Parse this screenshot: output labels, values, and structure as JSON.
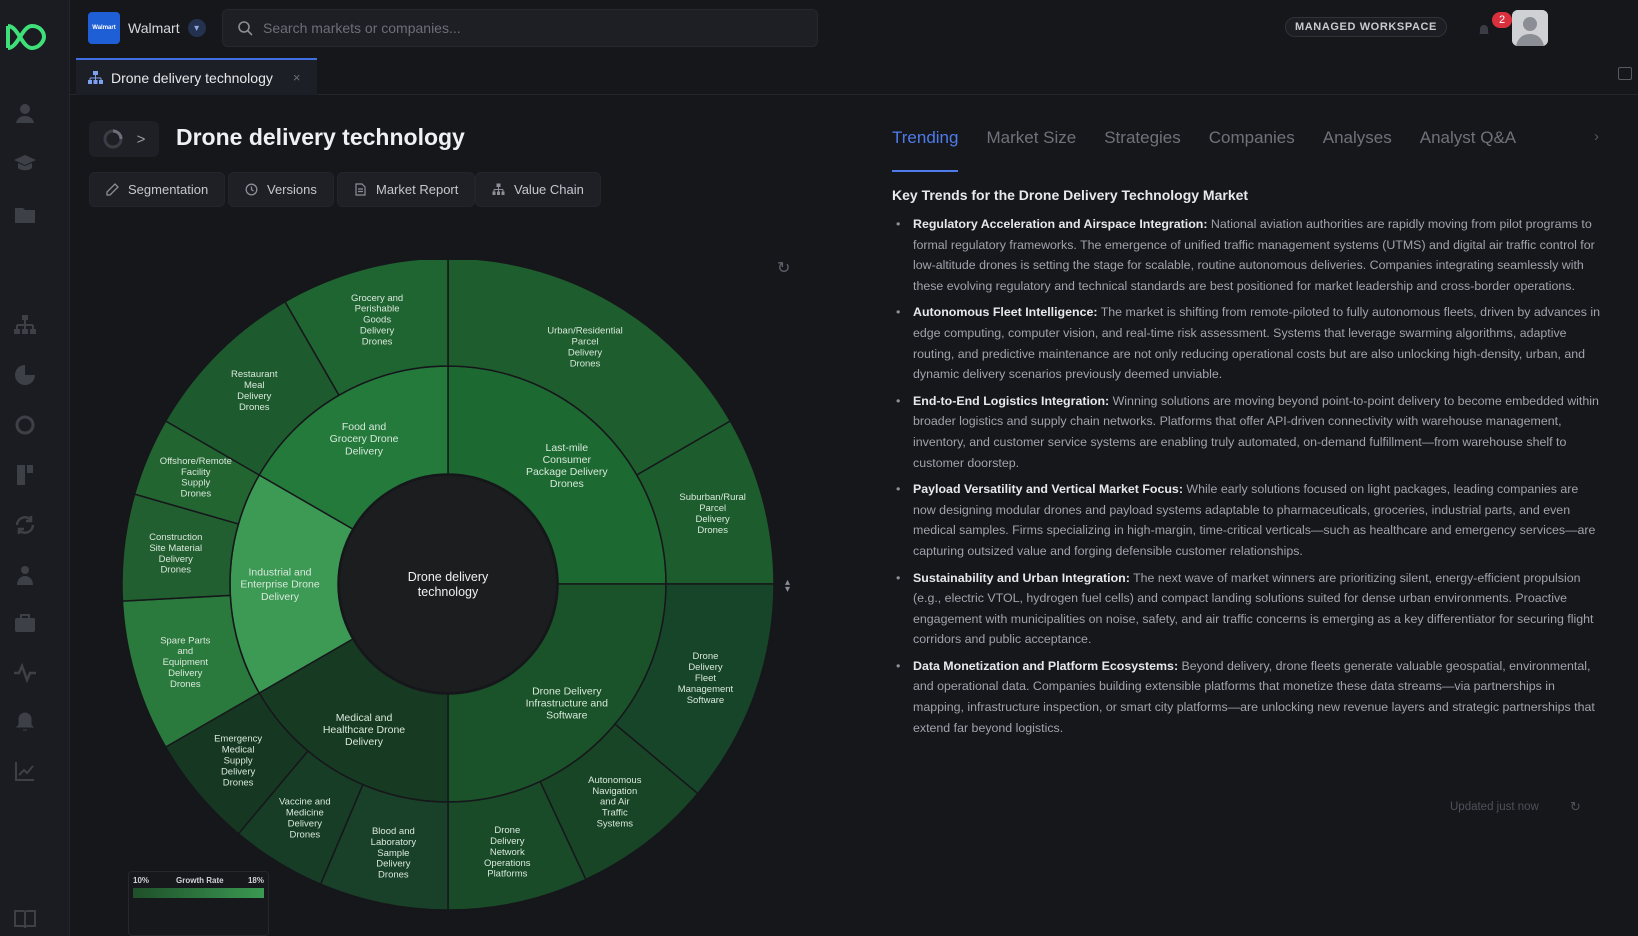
{
  "org": {
    "logo_text": "Walmart",
    "name": "Walmart"
  },
  "search": {
    "placeholder": "Search markets or companies..."
  },
  "header": {
    "workspace_label": "MANAGED WORKSPACE",
    "notification_count": "2"
  },
  "doc_tab": {
    "label": "Drone delivery technology",
    "close": "×"
  },
  "page": {
    "back_label": ">",
    "title": "Drone delivery technology",
    "actions": [
      "Segmentation",
      "Versions",
      "Market Report",
      "Value Chain"
    ]
  },
  "sunburst": {
    "center_label": [
      "Drone delivery",
      "technology"
    ],
    "segments": [
      {
        "name": [
          "Last-mile",
          "Consumer",
          "Package Delivery",
          "Drones"
        ],
        "color": "#1c6a31",
        "children": [
          {
            "name": [
              "Urban/Residential",
              "Parcel",
              "Delivery",
              "Drones"
            ],
            "color": "#1e5d2d"
          },
          {
            "name": [
              "Suburban/Rural",
              "Parcel",
              "Delivery",
              "Drones"
            ],
            "color": "#1d5c2d"
          }
        ]
      },
      {
        "name": [
          "Drone Delivery",
          "Infrastructure and",
          "Software"
        ],
        "color": "#1a5329",
        "children": [
          {
            "name": [
              "Drone",
              "Delivery",
              "Fleet",
              "Management",
              "Software"
            ],
            "color": "#17452a"
          },
          {
            "name": [
              "Autonomous",
              "Navigation",
              "and Air",
              "Traffic",
              "Systems"
            ],
            "color": "#184526"
          },
          {
            "name": [
              "Drone",
              "Delivery",
              "Network",
              "Operations",
              "Platforms"
            ],
            "color": "#194b29"
          }
        ]
      },
      {
        "name": [
          "Medical and",
          "Healthcare Drone",
          "Delivery"
        ],
        "color": "#173a22",
        "children": [
          {
            "name": [
              "Blood and",
              "Laboratory",
              "Sample",
              "Delivery",
              "Drones"
            ],
            "color": "#19412a"
          },
          {
            "name": [
              "Vaccine and",
              "Medicine",
              "Delivery",
              "Drones"
            ],
            "color": "#173d26"
          },
          {
            "name": [
              "Emergency",
              "Medical",
              "Supply",
              "Delivery",
              "Drones"
            ],
            "color": "#163822"
          }
        ]
      },
      {
        "name": [
          "Industrial and",
          "Enterprise Drone",
          "Delivery"
        ],
        "color": "#3d9a55",
        "children": [
          {
            "name": [
              "Spare Parts",
              "and",
              "Equipment",
              "Delivery",
              "Drones"
            ],
            "color": "#2b7a3d"
          },
          {
            "name": [
              "Construction",
              "Site Material",
              "Delivery",
              "Drones"
            ],
            "color": "#215e30"
          },
          {
            "name": [
              "Offshore/Remote",
              "Facility",
              "Supply",
              "Drones"
            ],
            "color": "#236531"
          }
        ]
      },
      {
        "name": [
          "Food and",
          "Grocery Drone",
          "Delivery"
        ],
        "color": "#237a3b",
        "children": [
          {
            "name": [
              "Restaurant",
              "Meal",
              "Delivery",
              "Drones"
            ],
            "color": "#1d5a2d"
          },
          {
            "name": [
              "Grocery and",
              "Perishable",
              "Goods",
              "Delivery",
              "Drones"
            ],
            "color": "#1f6531"
          }
        ]
      }
    ]
  },
  "legend": {
    "low": "10%",
    "label": "Growth Rate",
    "high": "18%"
  },
  "tabs": [
    "Trending",
    "Market Size",
    "Strategies",
    "Companies",
    "Analyses",
    "Analyst Q&A"
  ],
  "trends_heading": "Key Trends for the Drone Delivery Technology Market",
  "trends": [
    {
      "title": "Regulatory Acceleration and Airspace Integration:",
      "text": " National aviation authorities are rapidly moving from pilot programs to formal regulatory frameworks. The emergence of unified traffic management systems (UTMS) and digital air traffic control for low-altitude drones is setting the stage for scalable, routine autonomous deliveries. Companies integrating seamlessly with these evolving regulatory and technical standards are best positioned for market leadership and cross-border operations."
    },
    {
      "title": "Autonomous Fleet Intelligence:",
      "text": " The market is shifting from remote-piloted to fully autonomous fleets, driven by advances in edge computing, computer vision, and real-time risk assessment. Systems that leverage swarming algorithms, adaptive routing, and predictive maintenance are not only reducing operational costs but are also unlocking high-density, urban, and dynamic delivery scenarios previously deemed unviable."
    },
    {
      "title": "End-to-End Logistics Integration:",
      "text": " Winning solutions are moving beyond point-to-point delivery to become embedded within broader logistics and supply chain networks. Platforms that offer API-driven connectivity with warehouse management, inventory, and customer service systems are enabling truly automated, on-demand fulfillment—from warehouse shelf to customer doorstep."
    },
    {
      "title": "Payload Versatility and Vertical Market Focus:",
      "text": " While early solutions focused on light packages, leading companies are now designing modular drones and payload systems adaptable to pharmaceuticals, groceries, industrial parts, and even medical samples. Firms specializing in high-margin, time-critical verticals—such as healthcare and emergency services—are capturing outsized value and forging defensible customer relationships."
    },
    {
      "title": "Sustainability and Urban Integration:",
      "text": " The next wave of market winners are prioritizing silent, energy-efficient propulsion (e.g., electric VTOL, hydrogen fuel cells) and compact landing solutions suited for dense urban environments. Proactive engagement with municipalities on noise, safety, and air traffic concerns is emerging as a key differentiator for securing flight corridors and public acceptance."
    },
    {
      "title": "Data Monetization and Platform Ecosystems:",
      "text": " Beyond delivery, drone fleets generate valuable geospatial, environmental, and operational data. Companies building extensible platforms that monetize these data streams—via partnerships in mapping, infrastructure inspection, or smart city platforms—are unlocking new revenue layers and strategic partnerships that extend far beyond logistics."
    }
  ],
  "footer": {
    "updated": "Updated just now"
  }
}
